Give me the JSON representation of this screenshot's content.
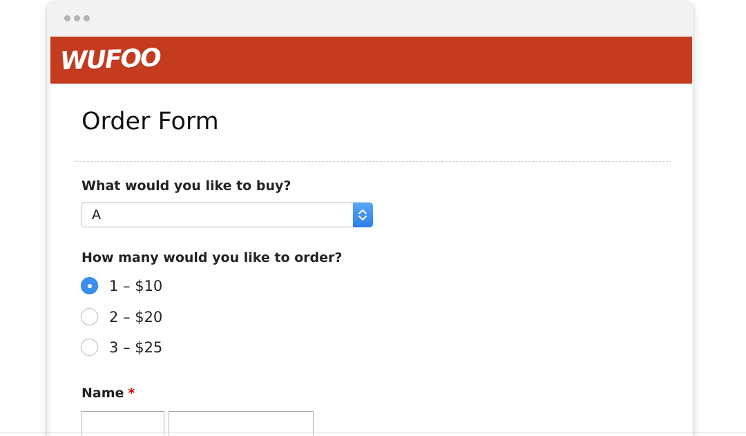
{
  "browser": {
    "window_dots": 3
  },
  "header": {
    "logo_text": "WUFOO",
    "brand_color": "#c43b1e"
  },
  "form": {
    "title": "Order Form",
    "questions": {
      "buy": {
        "label": "What would you like to buy?",
        "selected_value": "A"
      },
      "quantity": {
        "label": "How many would you like to order?",
        "options": [
          {
            "label": "1 – $10",
            "selected": true
          },
          {
            "label": "2 – $20",
            "selected": false
          },
          {
            "label": "3 – $25",
            "selected": false
          }
        ]
      },
      "name": {
        "label": "Name",
        "required_marker": "*"
      }
    }
  },
  "colors": {
    "radio_accent": "#3a8ff0",
    "required": "#d40000"
  }
}
